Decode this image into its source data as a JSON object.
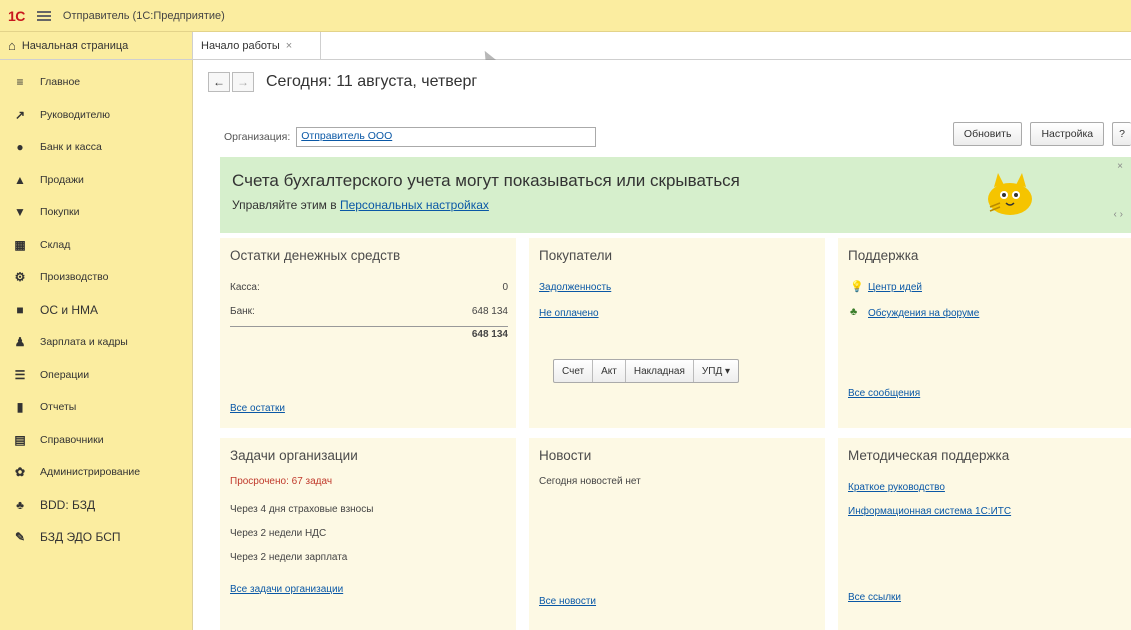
{
  "titlebar": {
    "logo": "1С",
    "title": "Отправитель  (1С:Предприятие)"
  },
  "tabs": {
    "home": "Начальная страница",
    "start": "Начало работы",
    "close": "×"
  },
  "sidebar": {
    "items": [
      {
        "label": "Главное",
        "icon": "≡"
      },
      {
        "label": "Руководителю",
        "icon": "↗"
      },
      {
        "label": "Банк и касса",
        "icon": "●"
      },
      {
        "label": "Продажи",
        "icon": "▲"
      },
      {
        "label": "Покупки",
        "icon": "▼"
      },
      {
        "label": "Склад",
        "icon": "▦"
      },
      {
        "label": "Производство",
        "icon": "⚙"
      },
      {
        "label": "ОС и НМА",
        "icon": "■"
      },
      {
        "label": "Зарплата и кадры",
        "icon": "♟"
      },
      {
        "label": "Операции",
        "icon": "☰"
      },
      {
        "label": "Отчеты",
        "icon": "▮"
      },
      {
        "label": "Справочники",
        "icon": "▤"
      },
      {
        "label": "Администрирование",
        "icon": "✿"
      },
      {
        "label": "BDD: БЗД",
        "icon": "♣"
      },
      {
        "label": "БЗД ЭДО БСП",
        "icon": "✎"
      }
    ]
  },
  "nav": {
    "back": "←",
    "forward": "→",
    "title": "Сегодня: 11 августа, четверг"
  },
  "org": {
    "label": "Организация:",
    "value": "Отправитель ООО"
  },
  "buttons": {
    "refresh": "Обновить",
    "settings": "Настройка",
    "help": "?"
  },
  "banner": {
    "title": "Счета бухгалтерского учета могут показываться или скрываться",
    "sub_prefix": "Управляйте этим в ",
    "sub_link": "Персональных настройках",
    "close": "×",
    "nav": "‹ ›"
  },
  "cash": {
    "title": "Остатки денежных средств",
    "rows": [
      {
        "label": "Касса:",
        "value": "0"
      },
      {
        "label": "Банк:",
        "value": "648 134"
      }
    ],
    "total": "648 134",
    "link": "Все остатки"
  },
  "buyers": {
    "title": "Покупатели",
    "link1": "Задолженность",
    "link2": "Не оплачено",
    "doc_buttons": [
      "Счет",
      "Акт",
      "Накладная",
      "УПД ▾"
    ]
  },
  "support": {
    "title": "Поддержка",
    "link1": "Центр идей",
    "link2": "Обсуждения на форуме",
    "link_all": "Все сообщения"
  },
  "tasks": {
    "title": "Задачи организации",
    "overdue": "Просрочено: 67 задач",
    "items": [
      "Через 4 дня страховые взносы",
      "Через 2 недели НДС",
      "Через 2 недели зарплата"
    ],
    "link": "Все задачи организации"
  },
  "news": {
    "title": "Новости",
    "text": "Сегодня новостей нет",
    "link": "Все новости"
  },
  "methodical": {
    "title": "Методическая поддержка",
    "link1": "Краткое руководство",
    "link2": "Информационная система 1С:ИТС",
    "link_all": "Все ссылки"
  }
}
